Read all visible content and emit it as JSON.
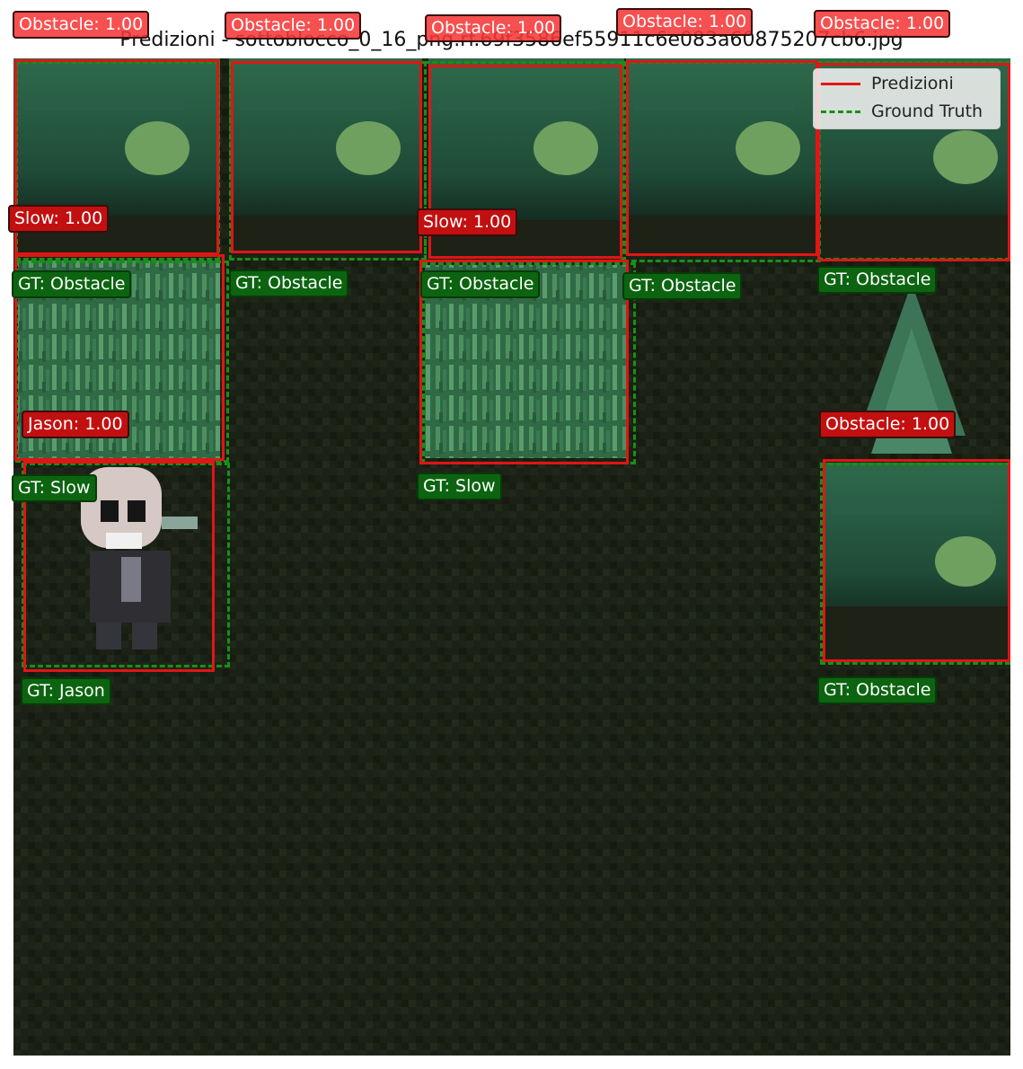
{
  "title": "Predizioni - sottoblocco_0_16_png.rf.69f3586ef55911c6e083a60875207cb6.jpg",
  "legend": {
    "predictions": "Predizioni",
    "ground_truth": "Ground Truth"
  },
  "colors": {
    "prediction": "#e01515",
    "ground_truth": "#169116",
    "label_prediction_top": "#f53838",
    "label_prediction": "#c21010",
    "label_ground_truth": "#0c6410",
    "scene_ground": "#1b2115"
  },
  "predictions": [
    {
      "label": "Obstacle: 1.00"
    },
    {
      "label": "Obstacle: 1.00"
    },
    {
      "label": "Obstacle: 1.00"
    },
    {
      "label": "Obstacle: 1.00"
    },
    {
      "label": "Obstacle: 1.00"
    },
    {
      "label": "Slow: 1.00"
    },
    {
      "label": "Slow: 1.00"
    },
    {
      "label": "Jason: 1.00"
    },
    {
      "label": "Obstacle: 1.00"
    }
  ],
  "ground_truth": [
    {
      "label": "GT: Obstacle"
    },
    {
      "label": "GT: Obstacle"
    },
    {
      "label": "GT: Obstacle"
    },
    {
      "label": "GT: Obstacle"
    },
    {
      "label": "GT: Obstacle"
    },
    {
      "label": "GT: Slow"
    },
    {
      "label": "GT: Slow"
    },
    {
      "label": "GT: Jason"
    },
    {
      "label": "GT: Obstacle"
    }
  ]
}
